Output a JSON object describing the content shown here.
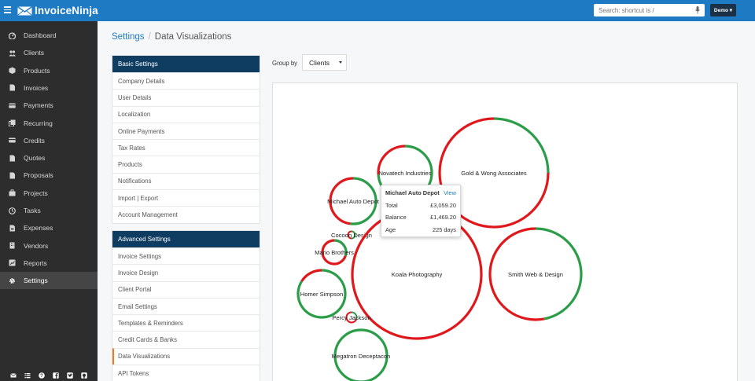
{
  "app": {
    "name": "InvoiceNinja"
  },
  "search": {
    "placeholder": "Search: shortcut is /"
  },
  "user_menu": {
    "label": "Demo ▾"
  },
  "sidebar": {
    "items": [
      {
        "label": "Dashboard",
        "icon": "dashboard-icon"
      },
      {
        "label": "Clients",
        "icon": "users-icon"
      },
      {
        "label": "Products",
        "icon": "cube-icon"
      },
      {
        "label": "Invoices",
        "icon": "file-icon"
      },
      {
        "label": "Payments",
        "icon": "credit-card-icon"
      },
      {
        "label": "Recurring",
        "icon": "files-icon"
      },
      {
        "label": "Credits",
        "icon": "credit-card-icon"
      },
      {
        "label": "Quotes",
        "icon": "file-icon"
      },
      {
        "label": "Proposals",
        "icon": "file-icon"
      },
      {
        "label": "Projects",
        "icon": "briefcase-icon"
      },
      {
        "label": "Tasks",
        "icon": "clock-icon"
      },
      {
        "label": "Expenses",
        "icon": "file-text-icon"
      },
      {
        "label": "Vendors",
        "icon": "building-icon"
      },
      {
        "label": "Reports",
        "icon": "chart-icon"
      },
      {
        "label": "Settings",
        "icon": "gear-icon",
        "active": true
      }
    ],
    "footer_icons": [
      "envelope-icon",
      "list-icon",
      "help-icon",
      "facebook-icon",
      "twitter-icon",
      "github-icon"
    ]
  },
  "breadcrumb": {
    "parent": "Settings",
    "separator": "/",
    "current": "Data Visualizations"
  },
  "basic_settings": {
    "title": "Basic Settings",
    "items": [
      "Company Details",
      "User Details",
      "Localization",
      "Online Payments",
      "Tax Rates",
      "Products",
      "Notifications",
      "Import | Export",
      "Account Management"
    ]
  },
  "advanced_settings": {
    "title": "Advanced Settings",
    "items": [
      "Invoice Settings",
      "Invoice Design",
      "Client Portal",
      "Email Settings",
      "Templates & Reminders",
      "Credit Cards & Banks",
      "Data Visualizations",
      "API Tokens"
    ],
    "active": "Data Visualizations"
  },
  "group_by": {
    "label": "Group by",
    "value": "Clients"
  },
  "colors": {
    "accent": "#1f7ac4",
    "paid": "#2b9d48",
    "balance": "#e0171b",
    "panel_header": "#0e3d61",
    "sidebar": "#2d2d2d"
  },
  "chart_data": {
    "type": "bubble",
    "bubbles": [
      {
        "name": "Gold & Wong Associates",
        "paid_fraction": 0.25
      },
      {
        "name": "Novatech Industries",
        "paid_fraction": 0.74
      },
      {
        "name": "Michael Auto Depot",
        "paid_fraction": 0.52
      },
      {
        "name": "Cocoon Design",
        "paid_fraction": 0.5
      },
      {
        "name": "Mario Brothers",
        "paid_fraction": 0.3
      },
      {
        "name": "Koala Photography",
        "paid_fraction": 0.12
      },
      {
        "name": "Smith Web & Design",
        "paid_fraction": 0.47
      },
      {
        "name": "Homer Simpson",
        "paid_fraction": 0.84
      },
      {
        "name": "Percy Jackson",
        "paid_fraction": 0.3
      },
      {
        "name": "Megatron Deceptacon",
        "paid_fraction": 1.0
      }
    ]
  },
  "tooltip": {
    "title": "Michael Auto Depot",
    "link": "View",
    "rows": [
      {
        "label": "Total",
        "value": "£3,059.20"
      },
      {
        "label": "Balance",
        "value": "£1,469.20"
      },
      {
        "label": "Age",
        "value": "225 days"
      }
    ]
  }
}
